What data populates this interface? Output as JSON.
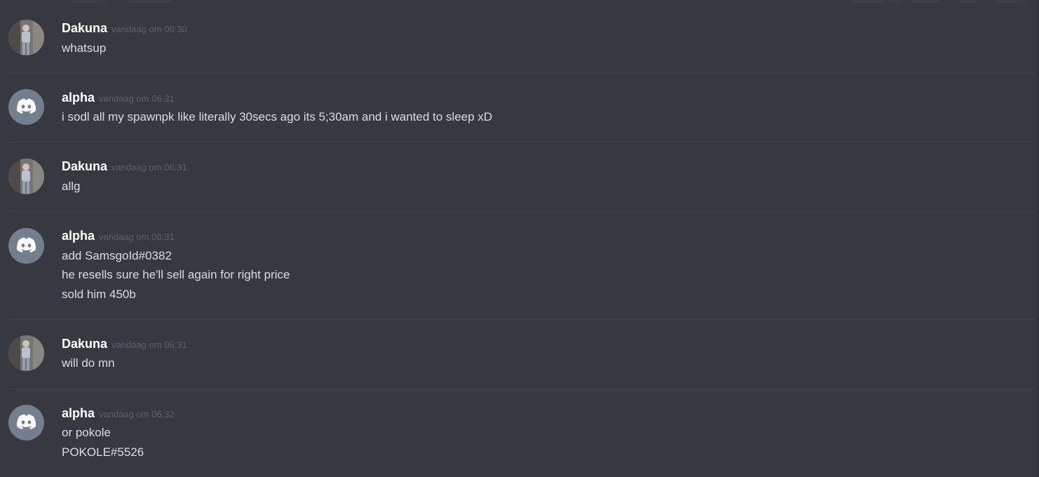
{
  "messages": [
    {
      "username": "Dakuna",
      "timestamp": "vandaag om 06:30",
      "avatar": "photo",
      "lines": [
        "whatsup"
      ]
    },
    {
      "username": "alpha",
      "timestamp": "vandaag om 06:31",
      "avatar": "discord-logo",
      "lines": [
        "i sodl all my spawnpk like literally 30secs ago its 5;30am and i wanted to sleep xD"
      ]
    },
    {
      "username": "Dakuna",
      "timestamp": "vandaag om 06:31",
      "avatar": "photo",
      "lines": [
        "allg"
      ]
    },
    {
      "username": "alpha",
      "timestamp": "vandaag om 06:31",
      "avatar": "discord-logo",
      "lines": [
        "add SamsgoId#0382",
        "he resells sure he'll sell again for right price",
        "sold him 450b"
      ]
    },
    {
      "username": "Dakuna",
      "timestamp": "vandaag om 06:31",
      "avatar": "photo",
      "lines": [
        "will do mn"
      ]
    },
    {
      "username": "alpha",
      "timestamp": "vandaag om 06:32",
      "avatar": "discord-logo",
      "lines": [
        "or pokole",
        "POKOLE#5526"
      ]
    }
  ],
  "colors": {
    "background": "#36393f",
    "username": "#ffffff",
    "timestamp": "#5b6068",
    "message_text": "#dcddde",
    "divider": "#40444b",
    "discord_avatar_bg": "#747f8d"
  }
}
